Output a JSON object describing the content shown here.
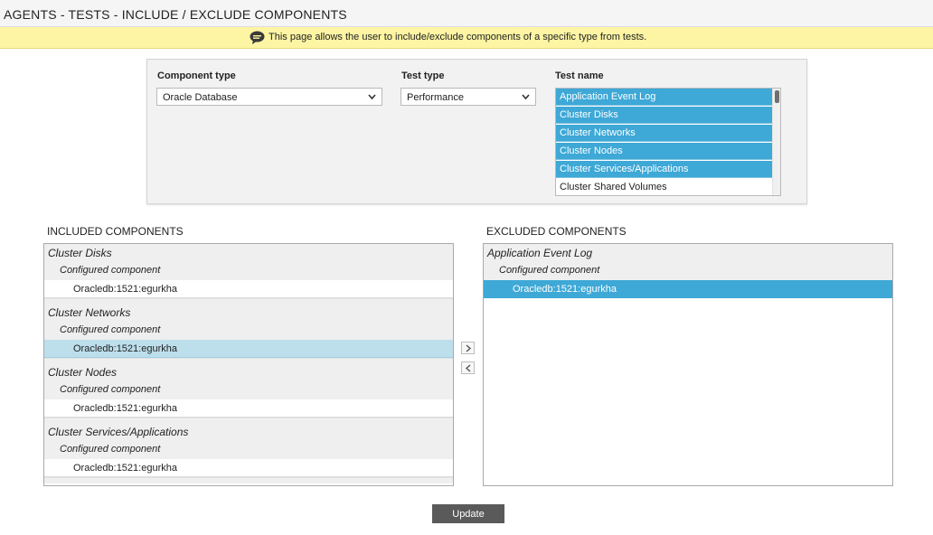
{
  "page": {
    "title": "AGENTS - TESTS - INCLUDE / EXCLUDE COMPONENTS",
    "info_icon": "speech-bubble-icon",
    "info_message": "This page allows the user to include/exclude components of a specific type from tests."
  },
  "filters": {
    "component_type": {
      "label": "Component type",
      "value": "Oracle Database"
    },
    "test_type": {
      "label": "Test type",
      "value": "Performance"
    },
    "test_name": {
      "label": "Test name",
      "options": [
        {
          "label": "Application Event Log",
          "selected": true
        },
        {
          "label": "Cluster Disks",
          "selected": true
        },
        {
          "label": "Cluster Networks",
          "selected": true
        },
        {
          "label": "Cluster Nodes",
          "selected": true
        },
        {
          "label": "Cluster Services/Applications",
          "selected": true
        },
        {
          "label": "Cluster Shared Volumes",
          "selected": false
        }
      ]
    }
  },
  "included": {
    "heading": "INCLUDED COMPONENTS",
    "groups": [
      {
        "test": "Cluster Disks",
        "sub_label": "Configured component",
        "items": [
          "Oracledb:1521:egurkha"
        ]
      },
      {
        "test": "Cluster Networks",
        "sub_label": "Configured component",
        "items": [
          "Oracledb:1521:egurkha"
        ]
      },
      {
        "test": "Cluster Nodes",
        "sub_label": "Configured component",
        "items": [
          "Oracledb:1521:egurkha"
        ]
      },
      {
        "test": "Cluster Services/Applications",
        "sub_label": "Configured component",
        "items": [
          "Oracledb:1521:egurkha"
        ]
      }
    ]
  },
  "excluded": {
    "heading": "EXCLUDED COMPONENTS",
    "groups": [
      {
        "test": "Application Event Log",
        "sub_label": "Configured component",
        "items": [
          "Oracledb:1521:egurkha"
        ]
      }
    ]
  },
  "actions": {
    "move_right_icon": "chevron-right-icon",
    "move_left_icon": "chevron-left-icon",
    "update_label": "Update"
  },
  "colors": {
    "info_bar": "#fdf5a3",
    "selection": "#3ea8d6",
    "highlight": "#bddfec",
    "button": "#5a5a5a"
  }
}
